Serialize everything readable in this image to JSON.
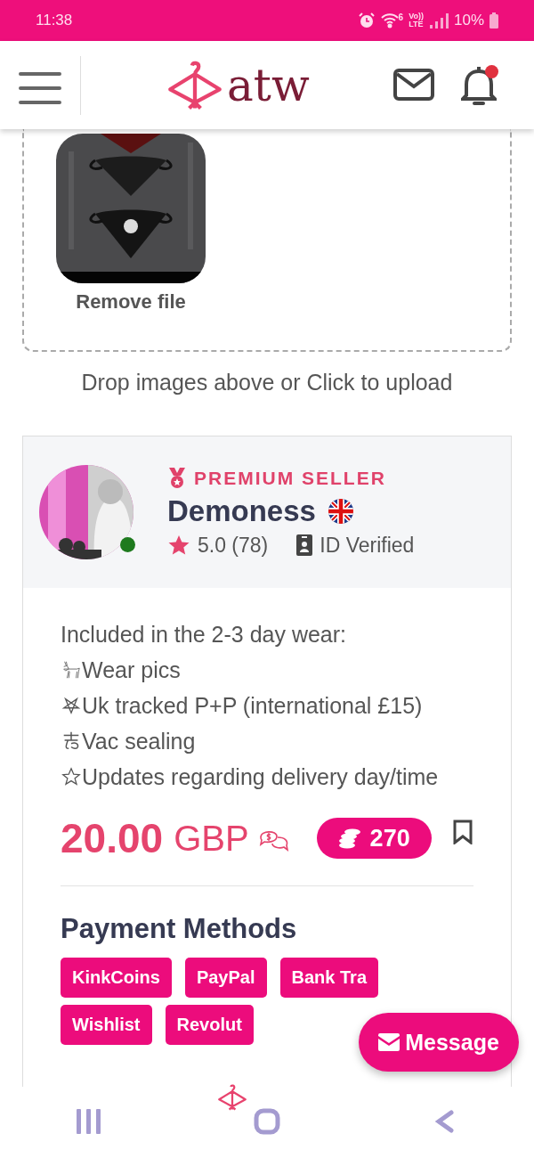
{
  "status_bar": {
    "time": "11:38",
    "wifi_label": "6",
    "network_labels": [
      "Vo))",
      "LTE"
    ],
    "battery": "10%"
  },
  "header": {
    "logo_text": "atw",
    "notifications_unread": true
  },
  "upload": {
    "remove_label": "Remove file",
    "hint": "Drop images above or Click to upload"
  },
  "seller": {
    "badge": "PREMIUM SELLER",
    "name": "Demoness",
    "online": true,
    "rating": "5.0 (78)",
    "verification": "ID Verified"
  },
  "description": {
    "intro": "Included in the 2-3 day wear:",
    "items": [
      {
        "kind": "goat",
        "text": "Wear pics"
      },
      {
        "kind": "pentagram",
        "text": "Uk tracked P+P (international £15)"
      },
      {
        "kind": "rune",
        "text": "Vac sealing"
      },
      {
        "kind": "star",
        "text": "Updates regarding delivery day/time"
      }
    ]
  },
  "price": {
    "amount": "20.00",
    "currency": "GBP",
    "coins": "270",
    "bookmarked": false
  },
  "payment": {
    "title": "Payment Methods",
    "methods": [
      "KinkCoins",
      "PayPal",
      "Bank Tra",
      "Wishlist",
      "Revolut"
    ]
  },
  "message_button": "Message"
}
